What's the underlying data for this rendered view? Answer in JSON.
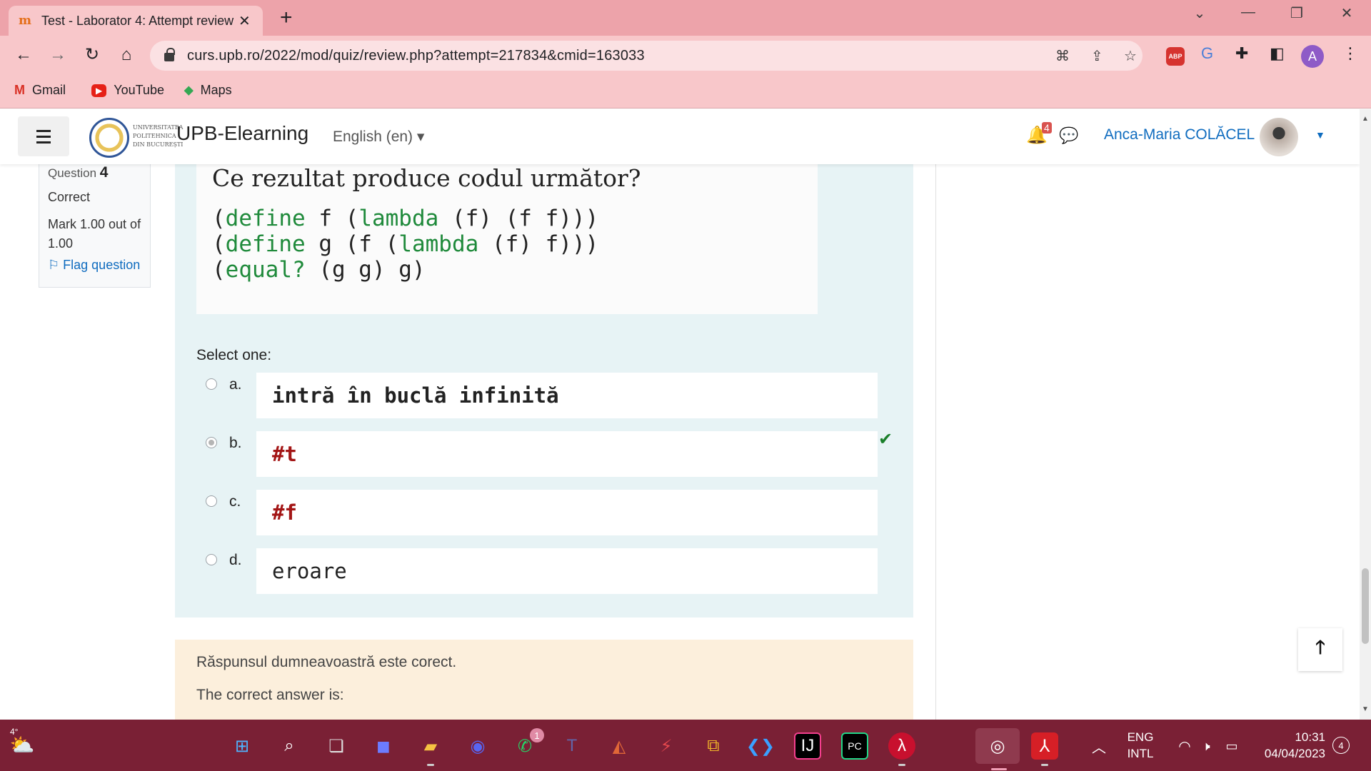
{
  "browser": {
    "tab_title": "Test - Laborator 4: Attempt review",
    "tab_favicon": "moodle-icon",
    "url": "curs.upb.ro/2022/mod/quiz/review.php?attempt=217834&cmid=163033",
    "profile_initial": "A",
    "abp_label": "ABP",
    "bookmarks": [
      {
        "label": "Gmail",
        "icon": "M"
      },
      {
        "label": "YouTube",
        "icon": "▶"
      },
      {
        "label": "Maps",
        "icon": "⬥"
      }
    ]
  },
  "moodle": {
    "site_name": "UPB-Elearning",
    "logo_text": [
      "UNIVERSITATEA",
      "POLITEHNICA",
      "DIN BUCUREȘTI"
    ],
    "language": "English ‎(en)‎",
    "notification_count": "4",
    "user_name": "Anca-Maria COLĂCEL"
  },
  "question_info": {
    "label": "Question",
    "number": "4",
    "state": "Correct",
    "grade": "Mark 1.00 out of 1.00",
    "flag": "Flag question"
  },
  "question": {
    "title": "Ce rezultat produce codul următor?",
    "code": [
      {
        "pre": "(",
        "kw": "define",
        "post": " f (",
        "kw2": "lambda",
        "post2": " (f) (f f)))"
      },
      {
        "pre": "(",
        "kw": "define",
        "post": " g (f (",
        "kw2": "lambda",
        "post2": " (f) f)))"
      },
      {
        "pre": "(",
        "kw": "equal?",
        "post": " (g g) g)",
        "kw2": "",
        "post2": ""
      }
    ],
    "prompt": "Select one:",
    "answers": [
      {
        "letter": "a.",
        "text": "intră în buclă infinită",
        "checked": false
      },
      {
        "letter": "b.",
        "text": "#t",
        "checked": true
      },
      {
        "letter": "c.",
        "text": "#f",
        "checked": false
      },
      {
        "letter": "d.",
        "text": "eroare",
        "checked": false
      }
    ]
  },
  "feedback": {
    "result": "Răspunsul dumneavoastră este corect.",
    "correct_answer": "The correct answer is:"
  },
  "taskbar": {
    "weather_temp": "4°",
    "whatsapp_badge": "1",
    "language": "ENG",
    "layout": "INTL",
    "time": "10:31",
    "date": "04/04/2023",
    "notifications": "4"
  },
  "colors": {
    "tab_strip": "#eda3aa",
    "toolbar": "#f8c7ca",
    "question_bg": "#e7f3f5",
    "feedback_bg": "#fcefdc",
    "link": "#0f6cbf",
    "code_keyword": "#1f8a3b",
    "boolean": "#a31515",
    "taskbar": "#7a2035"
  }
}
